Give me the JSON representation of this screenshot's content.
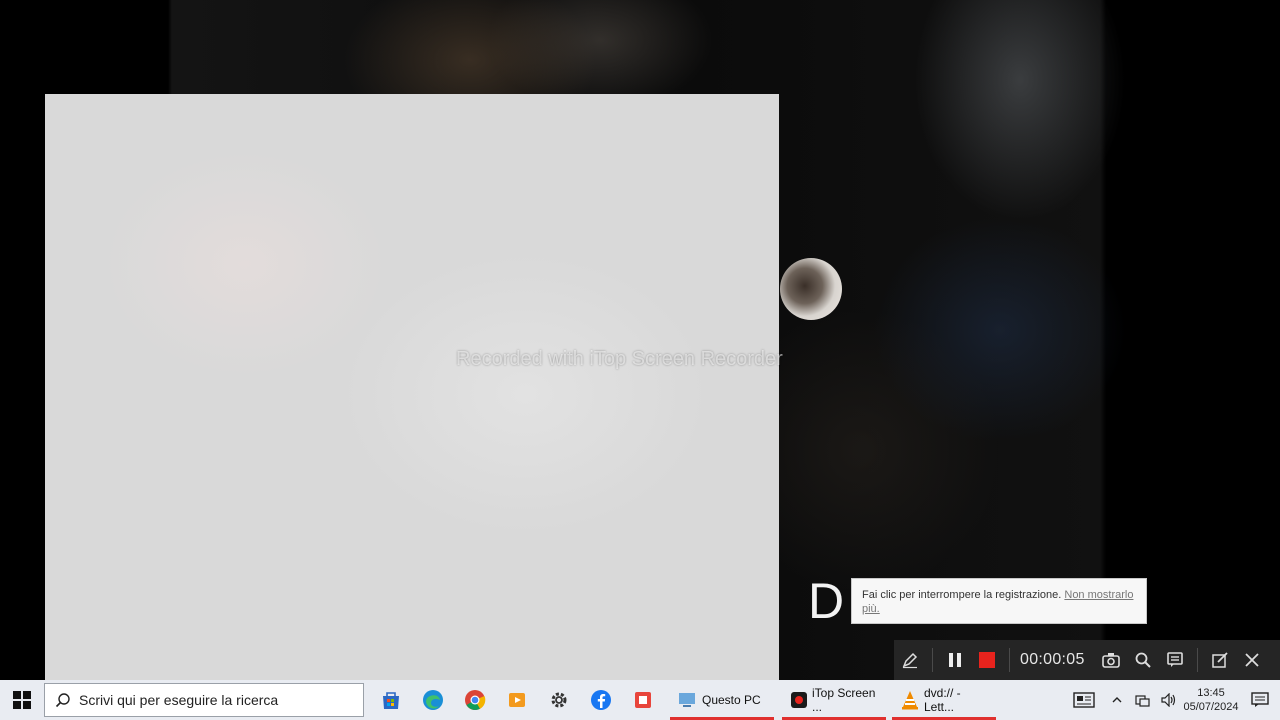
{
  "video": {
    "watermark": "Recorded with iTop Screen Recorder",
    "overlay_letter": "D"
  },
  "tooltip": {
    "text": "Fai clic per interrompere la registrazione.",
    "link": "Non mostrarlo più."
  },
  "recorder_bar": {
    "timer": "00:00:05",
    "icons": [
      "pen-icon",
      "pause-icon",
      "stop-icon",
      "camera-icon",
      "zoom-icon",
      "chat-icon",
      "edit-icon",
      "close-icon"
    ]
  },
  "taskbar": {
    "search_placeholder": "Scrivi qui per eseguire la ricerca",
    "pinned": [
      "store-icon",
      "edge-icon",
      "chrome-icon",
      "media-icon",
      "settings-icon",
      "facebook-icon",
      "recorder-icon"
    ],
    "apps": [
      {
        "label": "Questo PC"
      },
      {
        "label": "iTop Screen ..."
      },
      {
        "label": "dvd:// - Lett..."
      }
    ],
    "clock": {
      "time": "13:45",
      "date": "05/07/2024"
    },
    "accent": "#e0302f"
  }
}
